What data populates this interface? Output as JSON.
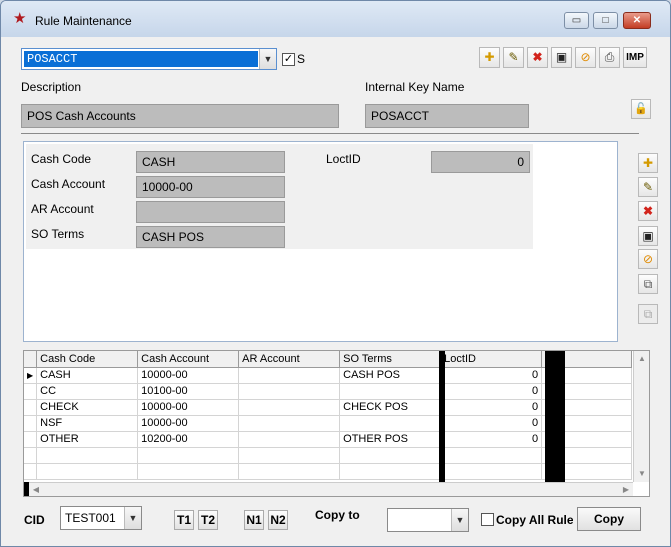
{
  "window": {
    "title": "Rule Maintenance",
    "min_glyph": "▭",
    "max_glyph": "□",
    "close_glyph": "✕"
  },
  "rule_select": {
    "value": "POSACCT",
    "checkbox_label": "S",
    "checkbox_checked": true
  },
  "toolbar": {
    "imp_label": "IMP"
  },
  "header": {
    "description_label": "Description",
    "description_value": "POS Cash Accounts",
    "internal_key_label": "Internal Key Name",
    "internal_key_value": "POSACCT"
  },
  "detail": {
    "cash_code_label": "Cash Code",
    "cash_code_value": "CASH",
    "cash_account_label": "Cash Account",
    "cash_account_value": "10000-00",
    "ar_account_label": "AR Account",
    "ar_account_value": "",
    "so_terms_label": "SO Terms",
    "so_terms_value": "CASH POS",
    "loctid_label": "LoctID",
    "loctid_value": "0"
  },
  "grid": {
    "columns": [
      "Cash Code",
      "Cash Account",
      "AR Account",
      "SO Terms",
      "LoctID"
    ],
    "rows": [
      {
        "marker": "▶",
        "cash_code": "CASH",
        "cash_account": "10000-00",
        "ar_account": "",
        "so_terms": "CASH POS",
        "loctid": "0"
      },
      {
        "marker": "",
        "cash_code": "CC",
        "cash_account": "10100-00",
        "ar_account": "",
        "so_terms": "",
        "loctid": "0"
      },
      {
        "marker": "",
        "cash_code": "CHECK",
        "cash_account": "10000-00",
        "ar_account": "",
        "so_terms": "CHECK POS",
        "loctid": "0"
      },
      {
        "marker": "",
        "cash_code": "NSF",
        "cash_account": "10000-00",
        "ar_account": "",
        "so_terms": "",
        "loctid": "0"
      },
      {
        "marker": "",
        "cash_code": "OTHER",
        "cash_account": "10200-00",
        "ar_account": "",
        "so_terms": "OTHER POS",
        "loctid": "0"
      }
    ]
  },
  "footer": {
    "cid_label": "CID",
    "cid_value": "TEST001",
    "t1": "T1",
    "t2": "T2",
    "n1": "N1",
    "n2": "N2",
    "copy_to_label": "Copy to",
    "copy_to_value": "",
    "copy_all_label": "Copy All Rules",
    "copy_button": "Copy"
  },
  "colors": {
    "accent": "#0078d7",
    "select_bg": "#0a6fd6"
  }
}
